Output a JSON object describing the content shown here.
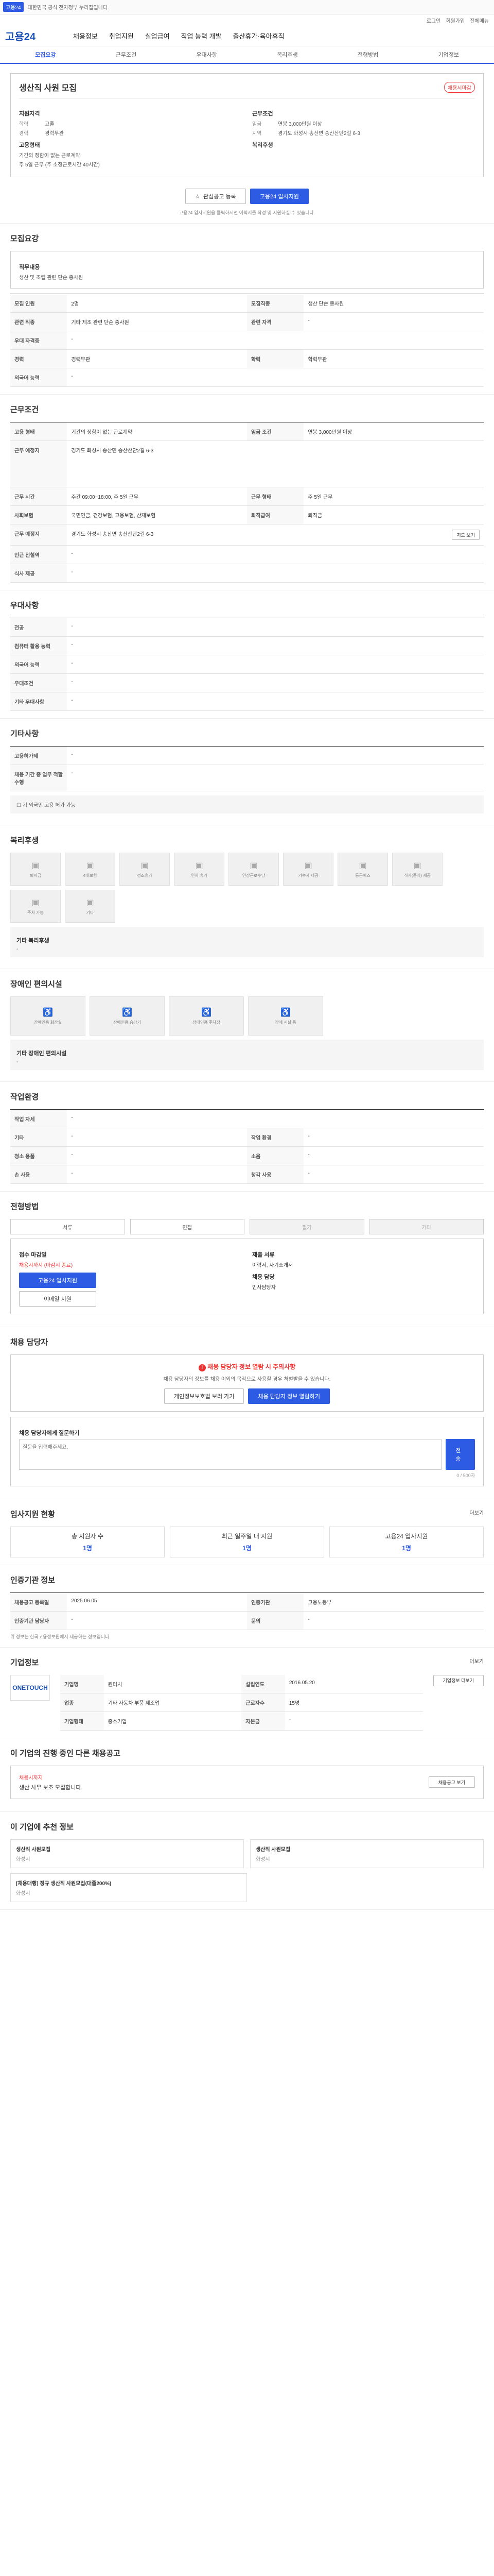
{
  "topbar": {
    "badge": "고용24",
    "notice": "대한민국 공식 전자정부 누리집입니다."
  },
  "util": [
    "로그인",
    "회원가입",
    "전체메뉴"
  ],
  "gnb": {
    "logo": "고용24",
    "menus": [
      "채용정보",
      "취업지원",
      "실업급여",
      "직업 능력 개발",
      "출산휴가·육아휴직"
    ]
  },
  "tabs": [
    "모집요강",
    "근무조건",
    "우대사항",
    "복리후생",
    "전형방법",
    "기업정보"
  ],
  "job": {
    "title": "생산직 사원 모집",
    "status": "채용시마감",
    "left_label": "지원자격",
    "edu_k": "학력",
    "edu_v": "고졸",
    "career_k": "경력",
    "career_v": "경력무관",
    "form_label": "고용형태",
    "form_v1": "기간의 정함이 없는 근로계약",
    "form_v2": "주 5일 근무 (주 소정근로시간 40시간)",
    "cond_label": "근무조건",
    "pay_k": "임금",
    "pay_v": "연봉 3,000만원 이상",
    "place_k": "지역",
    "place_v": "경기도 화성시 송산면 송산산단2길 6-3",
    "welfare_label": "복리후생"
  },
  "actions": {
    "save": "관심공고 등록",
    "apply": "고용24 입사지원",
    "hint": "고용24 입사지원을 클릭하시면 이력서를 작성 및 지원하실 수 있습니다."
  },
  "recruit": {
    "title": "모집요강",
    "duty_label": "직무내용",
    "duty_value": "생산 및 조립 관련 단순 종사원",
    "rows": [
      [
        "모집 인원",
        "2명",
        "모집직종",
        "생산 단순 종사원"
      ],
      [
        "관련 직종",
        "기타 제조 관련 단순 종사원",
        "관련 자격",
        "-"
      ],
      [
        "우대 자격증",
        "-",
        "",
        ""
      ],
      [
        "경력",
        "경력무관",
        "학력",
        "학력무관"
      ],
      [
        "외국어 능력",
        "-",
        "",
        ""
      ]
    ]
  },
  "work": {
    "title": "근무조건",
    "rows": [
      [
        "고용 형태",
        "기간의 정함이 없는 근로계약",
        "임금 조건",
        "연봉 3,000만원 이상"
      ],
      [
        "근무 예정지",
        "경기도 화성시 송산면 송산산단2길 6-3",
        "",
        ""
      ],
      [
        "근무 시간",
        "주간 09:00~18:00, 주 5일 근무",
        "근무 형태",
        "주 5일 근무"
      ],
      [
        "사회보험",
        "국민연금, 건강보험, 고용보험, 산재보험",
        "퇴직급여",
        "퇴직금"
      ],
      [
        "근무 예정지",
        "경기도 화성시 송산면 송산산단2길 6-3",
        "",
        ""
      ],
      [
        "인근 전철역",
        "-",
        "",
        ""
      ],
      [
        "식사 제공",
        "-",
        "",
        ""
      ]
    ],
    "map_button": "지도 보기"
  },
  "prefer": {
    "title": "우대사항",
    "rows": [
      [
        "전공",
        "-"
      ],
      [
        "컴퓨터 활용 능력",
        "-"
      ],
      [
        "외국어 능력",
        "-"
      ],
      [
        "우대조건",
        "-"
      ],
      [
        "기타 우대사항",
        "-"
      ]
    ]
  },
  "disabled": {
    "title": "기타사항",
    "rows": [
      [
        "고용허가제",
        "-"
      ],
      [
        "채용 기간 중 업무 적합 수행",
        "-"
      ]
    ],
    "check": "기 외국인 고용 허가 가능"
  },
  "welfare": {
    "title": "복리후생",
    "items": [
      "퇴직금",
      "4대보험",
      "경조휴가",
      "연차 휴가",
      "연장근로수당",
      "기숙사 제공",
      "통근버스",
      "식사(중식) 제공",
      "주차 가능",
      "기타"
    ],
    "other_label": "기타 복리후생",
    "other_value": "-"
  },
  "disability": {
    "title": "장애인 편의시설",
    "items": [
      "장애인용 화장실",
      "장애인용 승강기",
      "장애인용 주차장",
      "장애 시설 등"
    ],
    "other_label": "기타 장애인 편의시설",
    "other_value": "-"
  },
  "workplace": {
    "title": "작업환경",
    "rows": [
      [
        "작업 자세",
        "-",
        "",
        ""
      ],
      [
        "기타",
        "-",
        "작업 환경",
        "-"
      ],
      [
        "청소 용품",
        "-",
        "소음",
        "-"
      ],
      [
        "손 사용",
        "-",
        "청각 사용",
        "-"
      ]
    ]
  },
  "selection": {
    "title": "전형방법",
    "methods": [
      "서류",
      "면접",
      "필기",
      "기타"
    ],
    "apply_k": "접수 마감일",
    "apply_v": "채용시까지 (마감시 종료)",
    "apply_btn": "고용24 입사지원",
    "email_btn": "이메일 지원",
    "doc_k": "제출 서류",
    "doc_v": "이력서, 자기소개서",
    "manager_k": "채용 담당",
    "manager_v": "인사담당자"
  },
  "manager": {
    "title": "채용 담당자",
    "warn": "채용 담당자 정보 열람 시 주의사항",
    "desc": "채용 담당자의 정보를 채용 이외의 목적으로 사용할 경우 처벌받을 수 있습니다.",
    "btn1": "개인정보보호법 보러 가기",
    "btn2": "채용 담당자 정보 열람하기"
  },
  "question": {
    "title": "채용 담당자에게 질문하기",
    "placeholder": "질문을 입력해주세요.",
    "count": "0 / 500자",
    "submit": "전송"
  },
  "status": {
    "title": "입사지원 현황",
    "more": "더보기",
    "items": [
      [
        "총 지원자 수",
        "1명"
      ],
      [
        "최근 일주일 내 지원",
        "1명"
      ],
      [
        "고용24 입사지원",
        "1명"
      ]
    ]
  },
  "org": {
    "title": "인증기관 정보",
    "rows": [
      [
        "채용공고 등록일",
        "2025.06.05",
        "인증기관",
        "고용노동부"
      ],
      [
        "인증기관 담당자",
        "-",
        "문의",
        "-"
      ]
    ],
    "note": "위 정보는 한국고용정보원에서 제공하는 정보입니다."
  },
  "company": {
    "title": "기업정보",
    "more": "더보기",
    "logo": "ONETOUCH",
    "rows": [
      [
        "기업명",
        "원터치",
        "설립연도",
        "2016.05.20"
      ],
      [
        "업종",
        "기타 자동차 부품 제조업",
        "근로자수",
        "15명"
      ],
      [
        "기업형태",
        "중소기업",
        "자본금",
        "-"
      ]
    ],
    "detail": "기업정보 더보기"
  },
  "similar": {
    "title": "이 기업의 진행 중인 다른 채용공고",
    "items": [
      "채용시까지",
      "생산 사무 보조 모집합니다."
    ],
    "btn": "채용공고 보기"
  },
  "recommend": {
    "title": "이 기업에 추천 정보",
    "cards": [
      [
        "생산직 사원모집",
        "화성시"
      ],
      [
        "생산직 사원모집",
        "화성시"
      ],
      [
        "[채용대행] 정규 생산직 사원모집(대졸200%)",
        "화성시"
      ]
    ]
  }
}
